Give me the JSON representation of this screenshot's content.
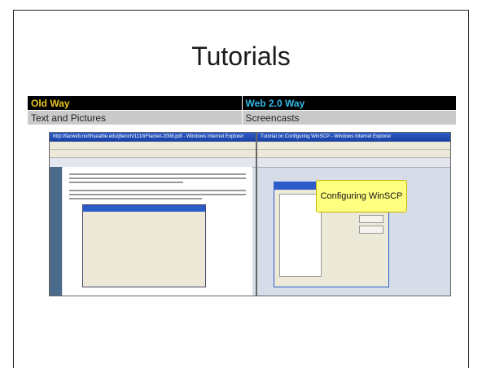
{
  "slide": {
    "title": "Tutorials"
  },
  "comparison_table": {
    "headers": [
      "Old Way",
      "Web 2.0 Way"
    ],
    "rows": [
      [
        "Text and Pictures",
        "Screencasts"
      ]
    ],
    "colors": {
      "old_way": "#e8c51c",
      "web20_way": "#35b8e8",
      "header_bg": "#000000",
      "row_bg": "#c9c9c9"
    }
  },
  "screenshot_old": {
    "window_title": "http://facweb.northseattle.edu/jbench/111/lrFlacket-2008.pdf - Windows Internet Explorer"
  },
  "screenshot_new": {
    "window_title": "Tutorial on Configuring WinSCP - Windows Internet Explorer",
    "callout": "Configuring WinSCP"
  }
}
